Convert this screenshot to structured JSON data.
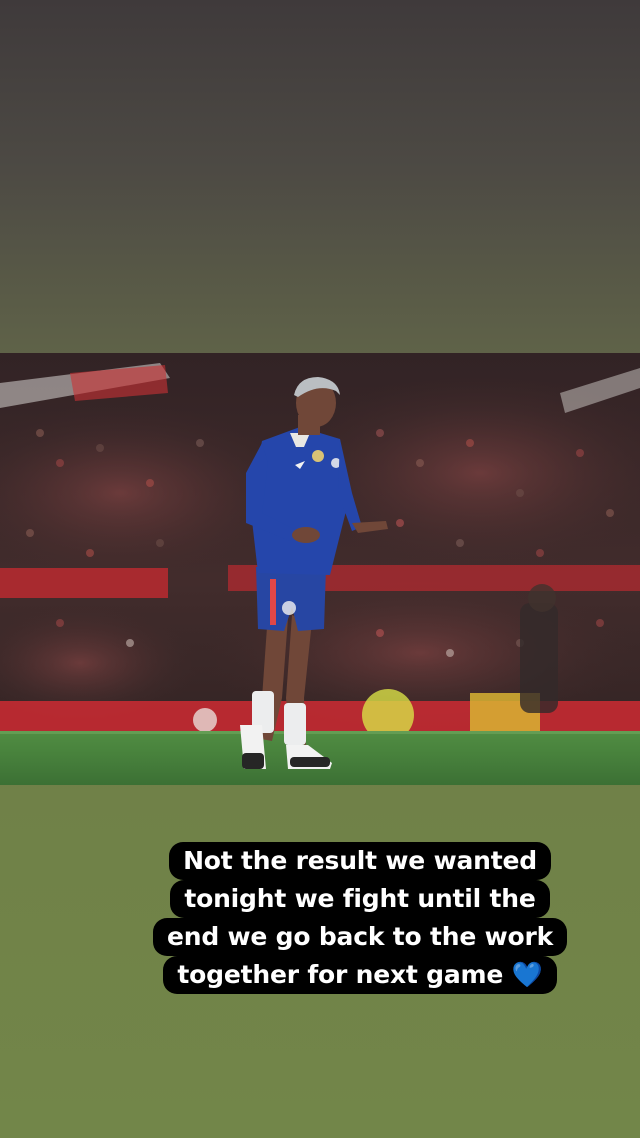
{
  "story": {
    "caption_lines": [
      "Not the result we wanted",
      "tonight we fight until the",
      "end we go back to the work",
      "together for next game"
    ],
    "caption_emoji": "💙",
    "colors": {
      "background_top": "#3f3a3b",
      "background_bottom": "#728649",
      "caption_bg": "#000000",
      "caption_text": "#ffffff",
      "kit_blue": "#1d3fa8",
      "pitch_green": "#3f7a34",
      "stand_red": "#c4222a"
    }
  }
}
